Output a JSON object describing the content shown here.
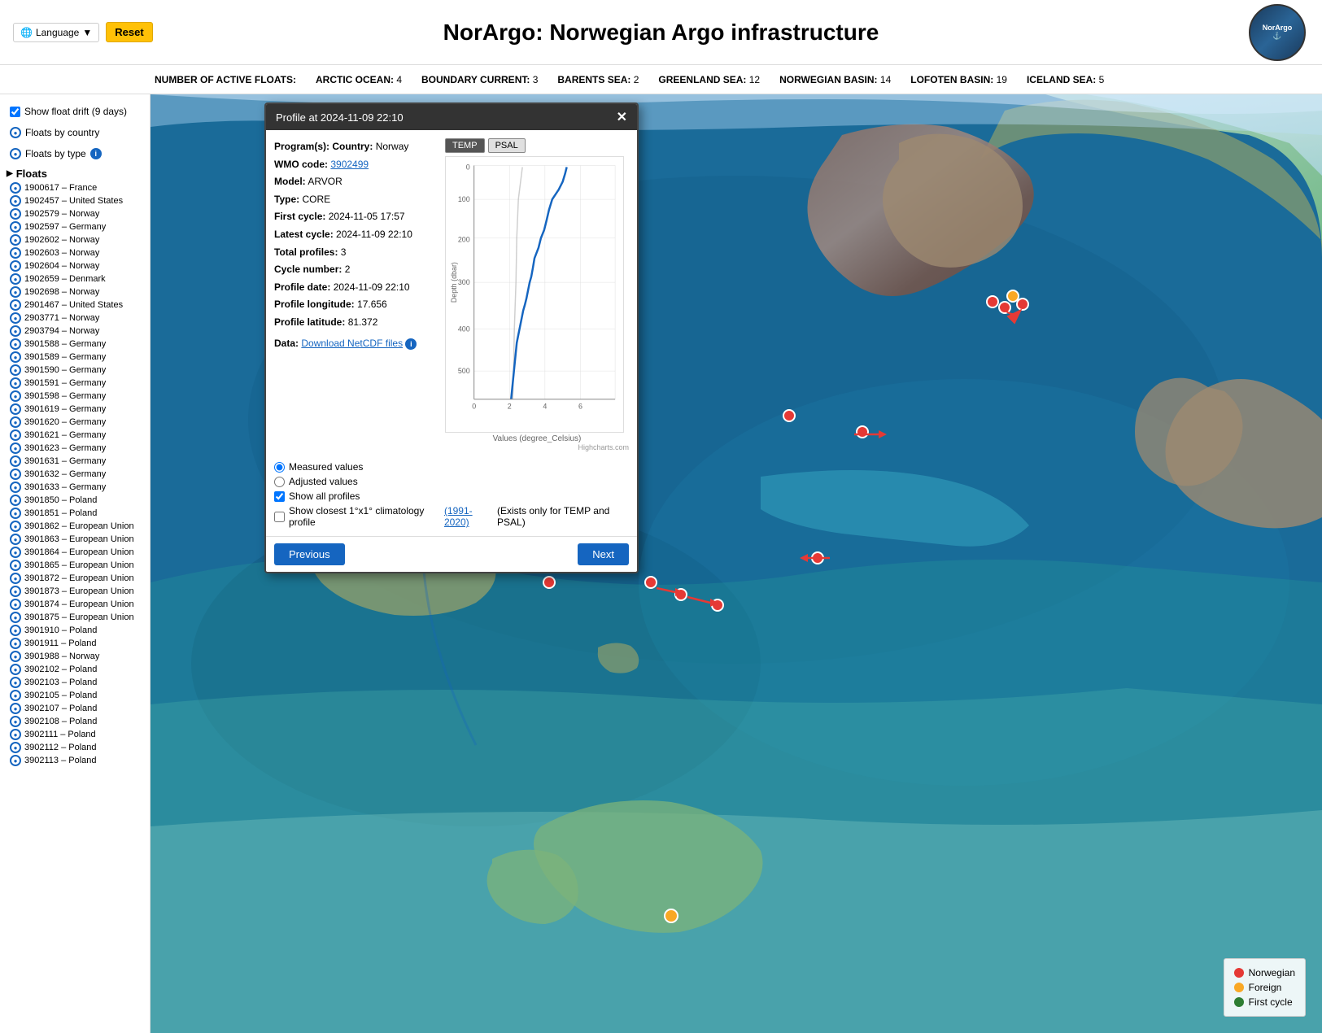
{
  "header": {
    "title": "NorArgo: Norwegian Argo infrastructure",
    "logo_text": "NorArgo",
    "lang_label": "Language",
    "reset_label": "Reset"
  },
  "stats_bar": {
    "prefix": "NUMBER OF ACTIVE FLOATS:",
    "items": [
      {
        "label": "ARCTIC OCEAN:",
        "value": "4"
      },
      {
        "label": "BOUNDARY CURRENT:",
        "value": "3"
      },
      {
        "label": "BARENTS SEA:",
        "value": "2"
      },
      {
        "label": "GREENLAND SEA:",
        "value": "12"
      },
      {
        "label": "NORWEGIAN BASIN:",
        "value": "14"
      },
      {
        "label": "LOFOTEN BASIN:",
        "value": "19"
      },
      {
        "label": "ICELAND SEA:",
        "value": "5"
      }
    ]
  },
  "sidebar": {
    "show_drift_label": "Show float drift (9 days)",
    "floats_by_country_label": "Floats by country",
    "floats_by_type_label": "Floats by type",
    "floats_label": "Floats",
    "floats": [
      "1900617 – France",
      "1902457 – United States",
      "1902579 – Norway",
      "1902597 – Germany",
      "1902602 – Norway",
      "1902603 – Norway",
      "1902604 – Norway",
      "1902659 – Denmark",
      "1902698 – Norway",
      "2901467 – United States",
      "2903771 – Norway",
      "2903794 – Norway",
      "3901588 – Germany",
      "3901589 – Germany",
      "3901590 – Germany",
      "3901591 – Germany",
      "3901598 – Germany",
      "3901619 – Germany",
      "3901620 – Germany",
      "3901621 – Germany",
      "3901623 – Germany",
      "3901631 – Germany",
      "3901632 – Germany",
      "3901633 – Germany",
      "3901850 – Poland",
      "3901851 – Poland",
      "3901862 – European Union",
      "3901863 – European Union",
      "3901864 – European Union",
      "3901865 – European Union",
      "3901872 – European Union",
      "3901873 – European Union",
      "3901874 – European Union",
      "3901875 – European Union",
      "3901910 – Poland",
      "3901911 – Poland",
      "3901988 – Norway",
      "3902102 – Poland",
      "3902103 – Poland",
      "3902105 – Poland",
      "3902107 – Poland",
      "3902108 – Poland",
      "3902111 – Poland",
      "3902112 – Poland",
      "3902113 – Poland"
    ]
  },
  "modal": {
    "title": "Profile at 2024-11-09 22:10",
    "program_label": "Program(s):",
    "country_label": "Country:",
    "country_value": "Norway",
    "wmo_label": "WMO code:",
    "wmo_value": "3902499",
    "wmo_link": "3902499",
    "model_label": "Model:",
    "model_value": "ARVOR",
    "type_label": "Type:",
    "type_value": "CORE",
    "first_cycle_label": "First cycle:",
    "first_cycle_value": "2024-11-05 17:57",
    "latest_cycle_label": "Latest cycle:",
    "latest_cycle_value": "2024-11-09 22:10",
    "total_profiles_label": "Total profiles:",
    "total_profiles_value": "3",
    "cycle_number_label": "Cycle number:",
    "cycle_number_value": "2",
    "profile_date_label": "Profile date:",
    "profile_date_value": "2024-11-09 22:10",
    "profile_longitude_label": "Profile longitude:",
    "profile_longitude_value": "17.656",
    "profile_latitude_label": "Profile latitude:",
    "profile_latitude_value": "81.372",
    "data_label": "Data:",
    "download_link": "Download NetCDF files",
    "tab_temp": "TEMP",
    "tab_psal": "PSAL",
    "measured_label": "Measured values",
    "adjusted_label": "Adjusted values",
    "show_all_profiles_label": "Show all profiles",
    "show_climatology_label": "Show closest 1°x1° climatology profile",
    "climatology_years": "(1991-2020)",
    "climatology_note": "(Exists only for TEMP and PSAL)",
    "chart_xlabel": "Values (degree_Celsius)",
    "highcharts_label": "Highcharts.com",
    "prev_label": "Previous",
    "next_label": "Next"
  },
  "legend": {
    "norwegian_label": "Norwegian",
    "foreign_label": "Foreign",
    "first_cycle_label": "First cycle"
  }
}
